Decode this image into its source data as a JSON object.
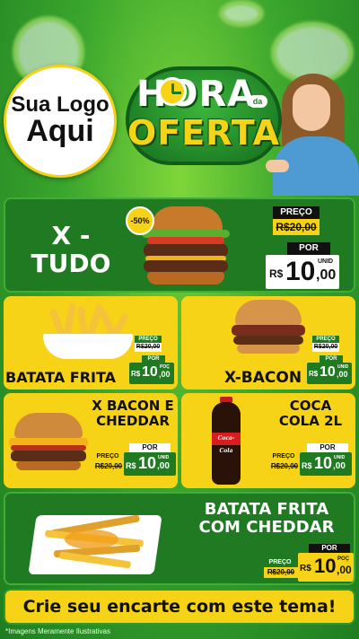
{
  "header": {
    "logo_line1": "Sua Logo",
    "logo_line2": "Aqui",
    "title_hora": "HORA",
    "title_da": "da",
    "title_oferta": "OFERTA"
  },
  "colors": {
    "green": "#1f7a22",
    "yellow": "#f7d317",
    "dark": "#111111"
  },
  "products": {
    "x_tudo": {
      "name_line1": "X -",
      "name_line2": "TUDO",
      "discount": "-50%",
      "price_label": "PREÇO",
      "old_price": "R$20,00",
      "por_label": "POR",
      "currency": "R$",
      "price_int": "10",
      "price_cents": ",00",
      "unit": "UNID"
    },
    "batata_frita": {
      "name": "BATATA FRITA",
      "price_label": "PREÇO",
      "old_price": "R$20,00",
      "por_label": "POR",
      "currency": "R$",
      "price_int": "10",
      "price_cents": ",00",
      "unit": "POÇ"
    },
    "x_bacon": {
      "name": "X-BACON",
      "price_label": "PREÇO",
      "old_price": "R$20,00",
      "por_label": "POR",
      "currency": "R$",
      "price_int": "10",
      "price_cents": ",00",
      "unit": "UNID"
    },
    "x_bacon_cheddar": {
      "name_line1": "X BACON E",
      "name_line2": "CHEDDAR",
      "price_label": "PREÇO",
      "old_price": "R$20,00",
      "por_label": "POR",
      "currency": "R$",
      "price_int": "10",
      "price_cents": ",00",
      "unit": "UNID"
    },
    "coca_cola": {
      "name_line1": "COCA",
      "name_line2": "COLA 2L",
      "price_label": "PREÇO",
      "old_price": "R$20,00",
      "por_label": "POR",
      "currency": "R$",
      "price_int": "10",
      "price_cents": ",00",
      "unit": "UNID",
      "bottle_label": "Coca-Cola"
    },
    "batata_cheddar": {
      "name_line1": "BATATA FRITA",
      "name_line2": "COM CHEDDAR",
      "price_label": "PREÇO",
      "old_price": "R$20,00",
      "por_label": "POR",
      "currency": "R$",
      "price_int": "10",
      "price_cents": ",00",
      "unit": "POÇ"
    }
  },
  "banner": {
    "text": "Crie seu encarte com este tema!"
  },
  "footnote": "*Imagens Meramente Ilustrativas"
}
